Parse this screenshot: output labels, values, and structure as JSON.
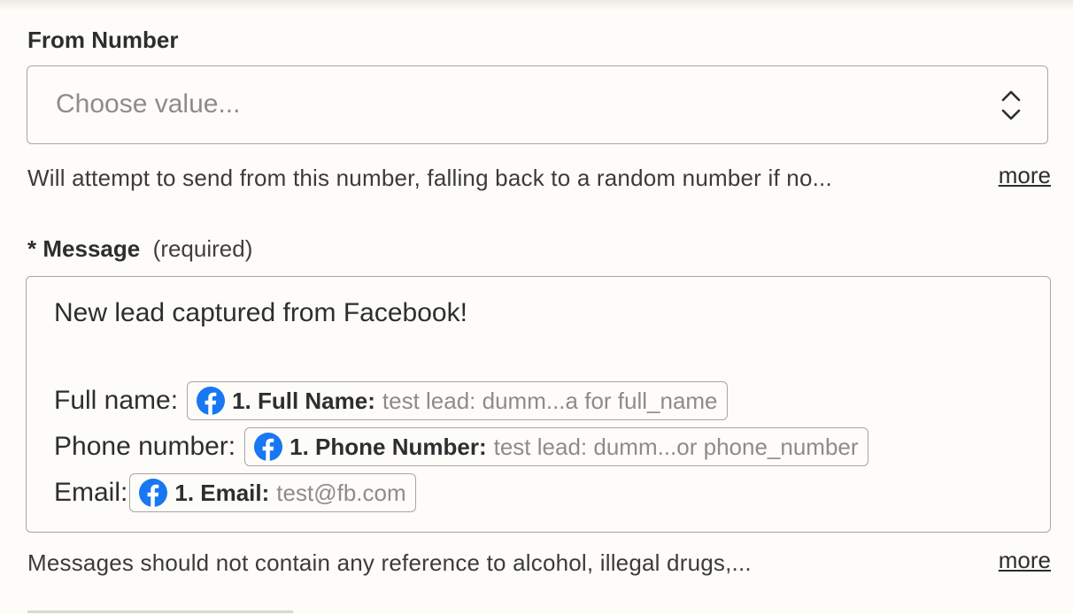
{
  "from_number": {
    "label": "From Number",
    "placeholder": "Choose value...",
    "help": "Will attempt to send from this number, falling back to a random number if no...",
    "more": "more"
  },
  "message": {
    "asterisk": "*",
    "label": "Message",
    "required": "(required)",
    "intro": "New lead captured from Facebook!",
    "lines": [
      {
        "prefix": "Full name:",
        "pill_label": "1. Full Name:",
        "pill_value": "test lead: dumm...a for full_name"
      },
      {
        "prefix": "Phone number:",
        "pill_label": "1. Phone Number:",
        "pill_value": "test lead: dumm...or phone_number"
      },
      {
        "prefix": "Email:",
        "pill_label": "1. Email:",
        "pill_value": "test@fb.com"
      }
    ],
    "help": "Messages should not contain any reference to alcohol, illegal drugs,...",
    "more": "more"
  },
  "icons": {
    "select": "chevron-up-down-icon",
    "pill": "facebook-icon"
  },
  "colors": {
    "background": "#fdfcf8",
    "border": "#a7a6a4",
    "facebook": "#1877f2",
    "placeholder": "#8d8c8a"
  }
}
